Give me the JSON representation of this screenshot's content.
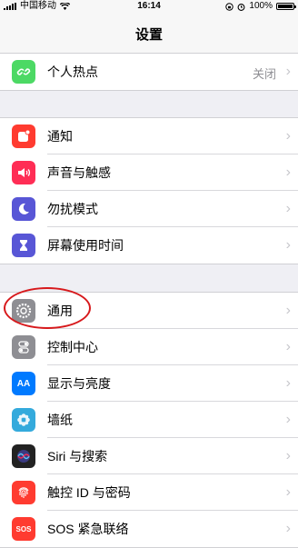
{
  "status_bar": {
    "carrier": "中国移动",
    "time": "16:14",
    "battery": "100%",
    "battery_level": 1.0
  },
  "navbar": {
    "title": "设置"
  },
  "groups": [
    {
      "items": [
        {
          "label": "个人热点",
          "value": "关闭",
          "icon": "hotspot-icon",
          "color": "#4cd964"
        }
      ]
    },
    {
      "items": [
        {
          "label": "通知",
          "icon": "notification-icon",
          "color": "#ff3b30"
        },
        {
          "label": "声音与触感",
          "icon": "speaker-icon",
          "color": "#ff2d55"
        },
        {
          "label": "勿扰模式",
          "icon": "moon-icon",
          "color": "#5856d6"
        },
        {
          "label": "屏幕使用时间",
          "icon": "hourglass-icon",
          "color": "#5856d6"
        }
      ]
    },
    {
      "items": [
        {
          "label": "通用",
          "icon": "gear-icon",
          "color": "#8e8e93"
        },
        {
          "label": "控制中心",
          "icon": "toggle-icon",
          "color": "#8e8e93"
        },
        {
          "label": "显示与亮度",
          "icon": "text-size-icon",
          "color": "#007aff",
          "icon_text": "AA"
        },
        {
          "label": "墙纸",
          "icon": "flower-icon",
          "color": "#34aadc"
        },
        {
          "label": "Siri 与搜索",
          "icon": "siri-icon",
          "color": "#222222"
        },
        {
          "label": "触控 ID 与密码",
          "icon": "fingerprint-icon",
          "color": "#ff3b30"
        },
        {
          "label": "SOS 紧急联络",
          "icon": "sos-icon",
          "color": "#ff3b30",
          "icon_text": "SOS"
        }
      ]
    }
  ],
  "annotation_color": "#d7191c"
}
